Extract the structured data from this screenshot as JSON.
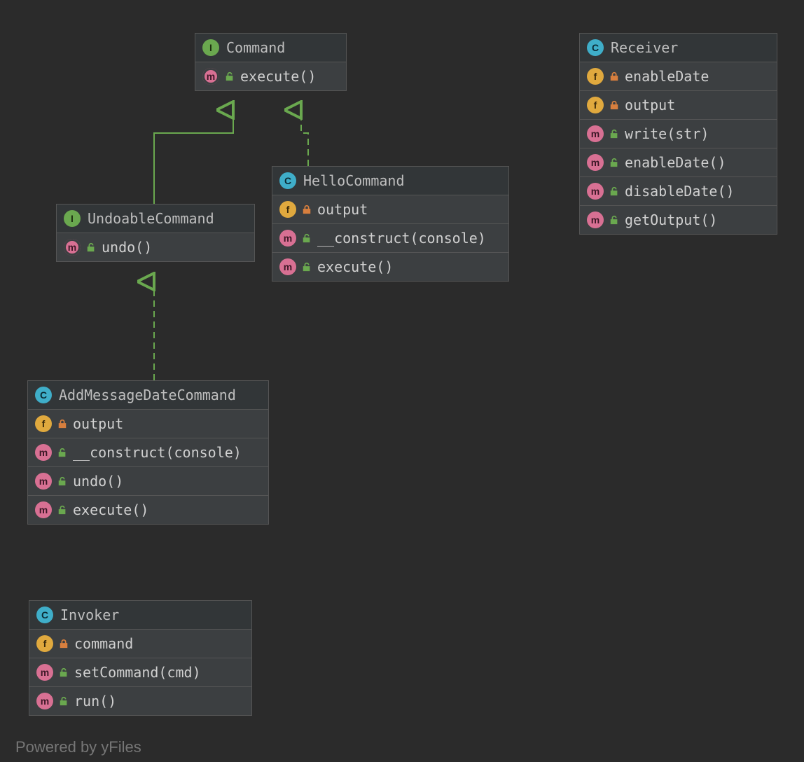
{
  "watermark": "Powered by yFiles",
  "classes": {
    "command": {
      "name": "Command",
      "kind": "I",
      "members": [
        {
          "kind": "m",
          "vis": "public",
          "abstract": true,
          "label": "execute()"
        }
      ]
    },
    "undoable": {
      "name": "UndoableCommand",
      "kind": "I",
      "members": [
        {
          "kind": "m",
          "vis": "public",
          "abstract": true,
          "label": "undo()"
        }
      ]
    },
    "hello": {
      "name": "HelloCommand",
      "kind": "C",
      "members": [
        {
          "kind": "f",
          "vis": "private",
          "label": "output"
        },
        {
          "kind": "m",
          "vis": "public",
          "label": "__construct(console)"
        },
        {
          "kind": "m",
          "vis": "public",
          "label": "execute()"
        }
      ]
    },
    "addmsg": {
      "name": "AddMessageDateCommand",
      "kind": "C",
      "members": [
        {
          "kind": "f",
          "vis": "private",
          "label": "output"
        },
        {
          "kind": "m",
          "vis": "public",
          "label": "__construct(console)"
        },
        {
          "kind": "m",
          "vis": "public",
          "label": "undo()"
        },
        {
          "kind": "m",
          "vis": "public",
          "label": "execute()"
        }
      ]
    },
    "invoker": {
      "name": "Invoker",
      "kind": "C",
      "members": [
        {
          "kind": "f",
          "vis": "private",
          "label": "command"
        },
        {
          "kind": "m",
          "vis": "public",
          "label": "setCommand(cmd)"
        },
        {
          "kind": "m",
          "vis": "public",
          "label": "run()"
        }
      ]
    },
    "receiver": {
      "name": "Receiver",
      "kind": "C",
      "members": [
        {
          "kind": "f",
          "vis": "private",
          "label": "enableDate"
        },
        {
          "kind": "f",
          "vis": "private",
          "label": "output"
        },
        {
          "kind": "m",
          "vis": "public",
          "label": "write(str)"
        },
        {
          "kind": "m",
          "vis": "public",
          "label": "enableDate()"
        },
        {
          "kind": "m",
          "vis": "public",
          "label": "disableDate()"
        },
        {
          "kind": "m",
          "vis": "public",
          "label": "getOutput()"
        }
      ]
    }
  }
}
